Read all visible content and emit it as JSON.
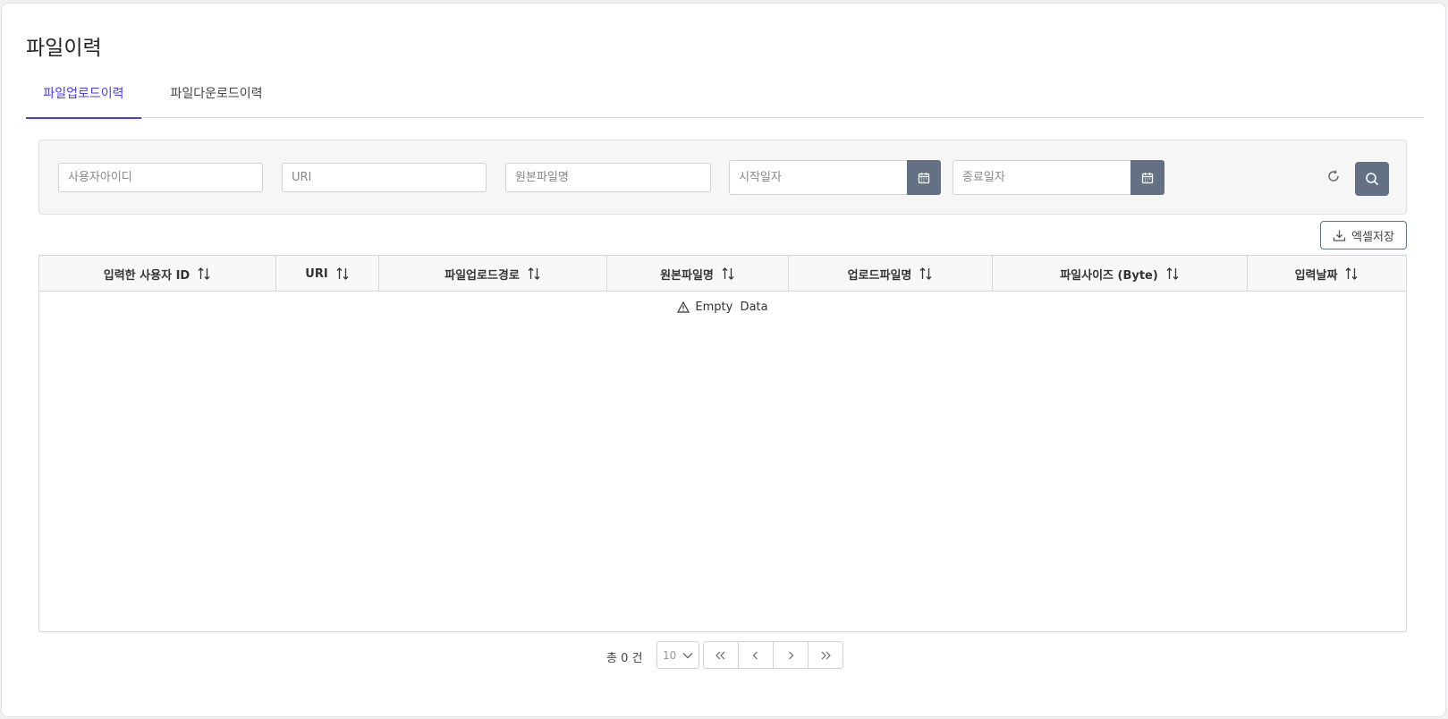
{
  "page": {
    "title": "파일이력"
  },
  "tabs": [
    {
      "label": "파일업로드이력",
      "active": true
    },
    {
      "label": "파일다운로드이력",
      "active": false
    }
  ],
  "filters": {
    "user_id": {
      "placeholder": "사용자아이디",
      "value": ""
    },
    "uri": {
      "placeholder": "URI",
      "value": ""
    },
    "original_file": {
      "placeholder": "원본파일명",
      "value": ""
    },
    "start_date": {
      "placeholder": "시작일자",
      "value": ""
    },
    "end_date": {
      "placeholder": "종료일자",
      "value": ""
    }
  },
  "toolbar": {
    "excel_label": "엑셀저장"
  },
  "table": {
    "columns": [
      "입력한 사용자 ID",
      "URI",
      "파일업로드경로",
      "원본파일명",
      "업로드파일명",
      "파일사이즈 (Byte)",
      "입력날짜"
    ],
    "rows": [],
    "empty_text": "Empty  Data"
  },
  "pagination": {
    "total_label": "총 0 건",
    "page_size": "10"
  },
  "colors": {
    "accent": "#4a3ee6",
    "button_bg": "#647185"
  },
  "icons": [
    "calendar-icon",
    "refresh-icon",
    "search-icon",
    "download-icon",
    "sort-icon",
    "warning-icon",
    "chevron-down-icon",
    "double-chevron-left-icon",
    "chevron-left-icon",
    "chevron-right-icon",
    "double-chevron-right-icon"
  ]
}
